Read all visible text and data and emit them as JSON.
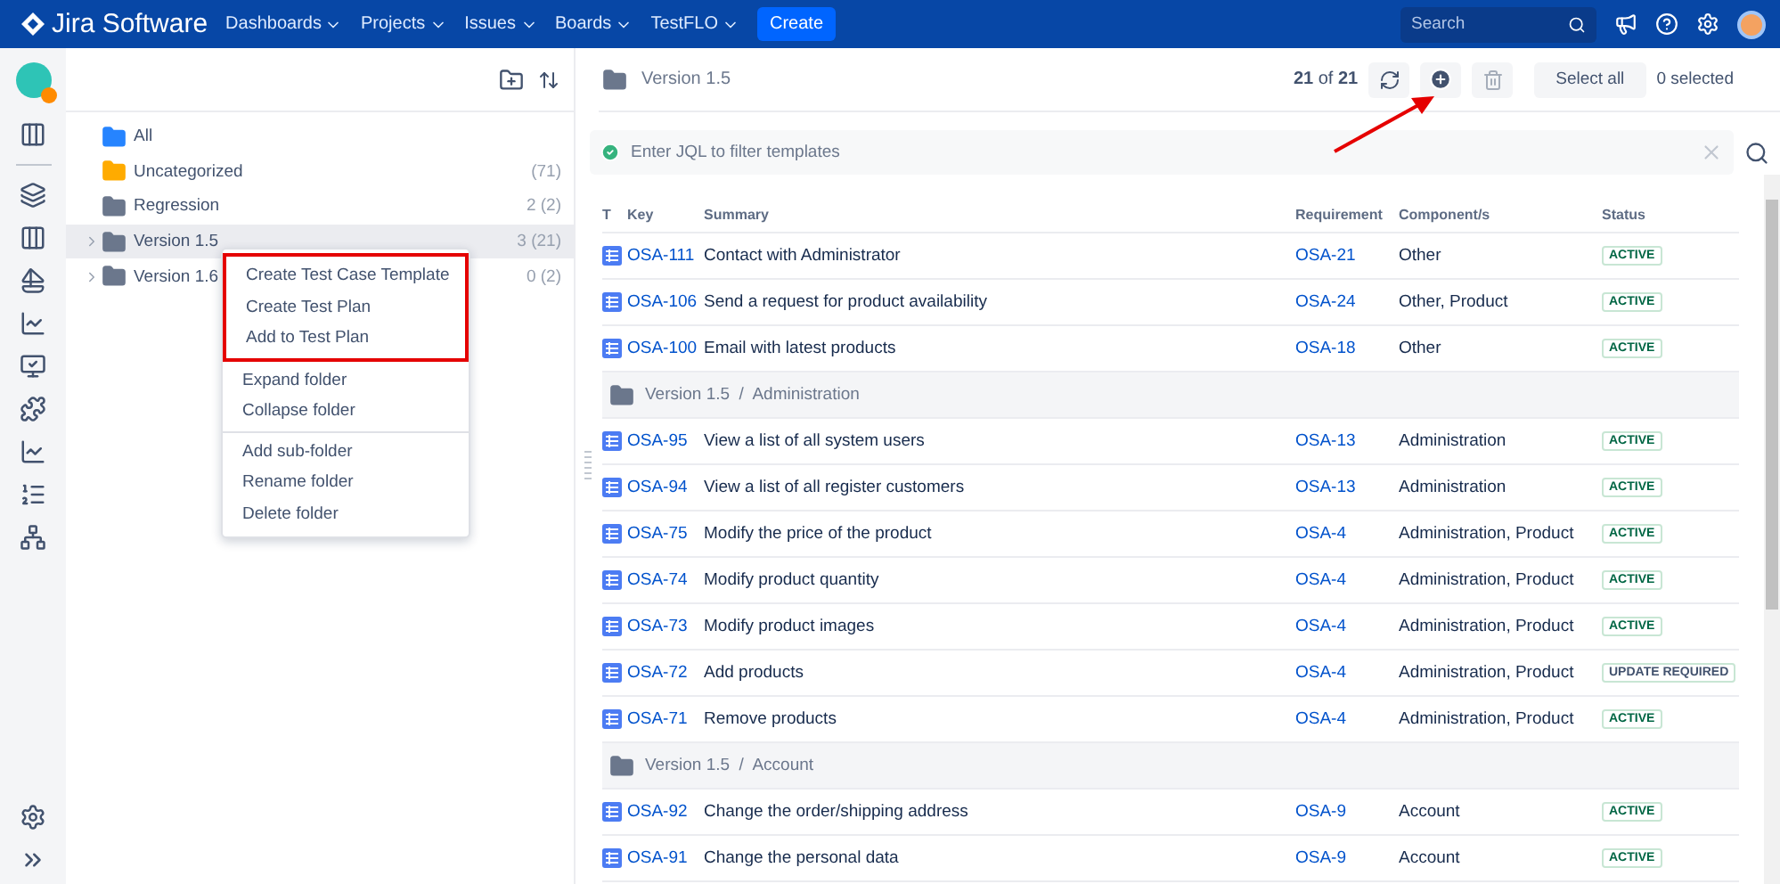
{
  "nav": {
    "brand": "Jira Software",
    "menus": [
      "Dashboards",
      "Projects",
      "Issues",
      "Boards",
      "TestFLO"
    ],
    "create": "Create",
    "search_placeholder": "Search"
  },
  "folders": [
    {
      "name": "All",
      "kind": "all",
      "selected": false
    },
    {
      "name": "Uncategorized",
      "count": "(71)",
      "kind": "uncategorized",
      "selected": false
    },
    {
      "name": "Regression",
      "count": "2 (2)",
      "kind": "folder",
      "selected": false
    },
    {
      "name": "Version 1.5",
      "count": "3 (21)",
      "kind": "expandable",
      "selected": true
    },
    {
      "name": "Version 1.6",
      "count": "0 (2)",
      "kind": "expandable",
      "selected": false
    }
  ],
  "context_menu": [
    {
      "highlighted": true,
      "items": [
        "Create Test Case Template",
        "Create Test Plan",
        "Add to Test Plan"
      ]
    },
    {
      "highlighted": false,
      "items": [
        "Expand folder",
        "Collapse folder"
      ]
    },
    {
      "highlighted": false,
      "items": [
        "Add sub-folder",
        "Rename folder",
        "Delete folder"
      ]
    }
  ],
  "header": {
    "folder": "Version 1.5",
    "counter": "**21** of **21**",
    "select_all": "Select all",
    "selected_count": "0 selected"
  },
  "filter": {
    "placeholder": "Enter JQL to filter templates"
  },
  "table": {
    "columns": [
      "T",
      "Key",
      "Summary",
      "Requirement",
      "Component/s",
      "Status"
    ],
    "rows": [
      {
        "kind": "item",
        "key": "OSA-111",
        "summary": "Contact with Administrator",
        "requirement": "OSA-21",
        "components": "Other",
        "status": "ACTIVE",
        "color": "#006644"
      },
      {
        "kind": "item",
        "key": "OSA-106",
        "summary": "Send a request for product availability",
        "requirement": "OSA-24",
        "components": "Other, Product",
        "status": "ACTIVE",
        "color": "#006644"
      },
      {
        "kind": "item",
        "key": "OSA-100",
        "summary": "Email with latest products",
        "requirement": "OSA-18",
        "components": "Other",
        "status": "ACTIVE",
        "color": "#006644"
      },
      {
        "kind": "group",
        "path": "Version 1.5  /  Administration"
      },
      {
        "kind": "item",
        "key": "OSA-95",
        "summary": "View a list of all system users",
        "requirement": "OSA-13",
        "components": "Administration",
        "status": "ACTIVE",
        "color": "#006644"
      },
      {
        "kind": "item",
        "key": "OSA-94",
        "summary": "View a list of all register customers",
        "requirement": "OSA-13",
        "components": "Administration",
        "status": "ACTIVE",
        "color": "#006644"
      },
      {
        "kind": "item",
        "key": "OSA-75",
        "summary": "Modify the price of the product",
        "requirement": "OSA-4",
        "components": "Administration, Product",
        "status": "ACTIVE",
        "color": "#006644"
      },
      {
        "kind": "item",
        "key": "OSA-74",
        "summary": "Modify product quantity",
        "requirement": "OSA-4",
        "components": "Administration, Product",
        "status": "ACTIVE",
        "color": "#006644"
      },
      {
        "kind": "item",
        "key": "OSA-73",
        "summary": "Modify product images",
        "requirement": "OSA-4",
        "components": "Administration, Product",
        "status": "ACTIVE",
        "color": "#006644"
      },
      {
        "kind": "item",
        "key": "OSA-72",
        "summary": "Add products",
        "requirement": "OSA-4",
        "components": "Administration, Product",
        "status": "UPDATE REQUIRED",
        "color": "#42526e"
      },
      {
        "kind": "item",
        "key": "OSA-71",
        "summary": "Remove products",
        "requirement": "OSA-4",
        "components": "Administration, Product",
        "status": "ACTIVE",
        "color": "#006644"
      },
      {
        "kind": "group",
        "path": "Version 1.5  /  Account"
      },
      {
        "kind": "item",
        "key": "OSA-92",
        "summary": "Change the order/shipping address",
        "requirement": "OSA-9",
        "components": "Account",
        "status": "ACTIVE",
        "color": "#006644"
      },
      {
        "kind": "item",
        "key": "OSA-91",
        "summary": "Change the personal data",
        "requirement": "OSA-9",
        "components": "Account",
        "status": "ACTIVE",
        "color": "#006644"
      }
    ]
  }
}
